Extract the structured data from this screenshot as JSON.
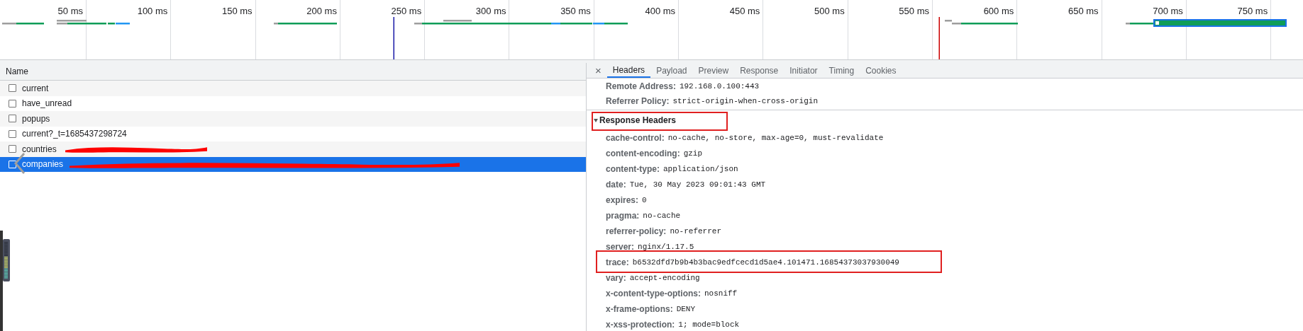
{
  "timeline": {
    "ticks": [
      "50 ms",
      "100 ms",
      "150 ms",
      "200 ms",
      "250 ms",
      "300 ms",
      "350 ms",
      "400 ms",
      "450 ms",
      "500 ms",
      "550 ms",
      "600 ms",
      "650 ms",
      "700 ms",
      "750 ms"
    ]
  },
  "request_list": {
    "column": "Name",
    "rows": [
      {
        "name": "current",
        "selected": false
      },
      {
        "name": "have_unread",
        "selected": false
      },
      {
        "name": "popups",
        "selected": false
      },
      {
        "name": "current?_t=1685437298724",
        "selected": false
      },
      {
        "name": "countries",
        "selected": false,
        "redacted": true
      },
      {
        "name": "companies",
        "selected": true,
        "redacted": true
      }
    ]
  },
  "details": {
    "close": "×",
    "tabs": [
      {
        "label": "Headers",
        "selected": true
      },
      {
        "label": "Payload",
        "selected": false
      },
      {
        "label": "Preview",
        "selected": false
      },
      {
        "label": "Response",
        "selected": false
      },
      {
        "label": "Initiator",
        "selected": false
      },
      {
        "label": "Timing",
        "selected": false
      },
      {
        "label": "Cookies",
        "selected": false
      }
    ],
    "general": [
      {
        "label": "Remote Address:",
        "value": "192.168.0.100:443"
      },
      {
        "label": "Referrer Policy:",
        "value": "strict-origin-when-cross-origin"
      }
    ],
    "response_headers": {
      "title": "Response Headers",
      "expanded": true,
      "highlighted": true,
      "headers": [
        {
          "name": "cache-control:",
          "value": "no-cache, no-store, max-age=0, must-revalidate",
          "highlighted": false
        },
        {
          "name": "content-encoding:",
          "value": "gzip",
          "highlighted": false
        },
        {
          "name": "content-type:",
          "value": "application/json",
          "highlighted": false
        },
        {
          "name": "date:",
          "value": "Tue, 30 May 2023 09:01:43 GMT",
          "highlighted": false
        },
        {
          "name": "expires:",
          "value": "0",
          "highlighted": false
        },
        {
          "name": "pragma:",
          "value": "no-cache",
          "highlighted": false
        },
        {
          "name": "referrer-policy:",
          "value": "no-referrer",
          "highlighted": false
        },
        {
          "name": "server:",
          "value": "nginx/1.17.5",
          "highlighted": false
        },
        {
          "name": "trace:",
          "value": "b6532dfd7b9b4b3bac9edfcecd1d5ae4.101471.16854373037930049",
          "highlighted": true
        },
        {
          "name": "vary:",
          "value": "accept-encoding",
          "highlighted": false
        },
        {
          "name": "x-content-type-options:",
          "value": "nosniff",
          "highlighted": false
        },
        {
          "name": "x-frame-options:",
          "value": "DENY",
          "highlighted": false
        },
        {
          "name": "x-xss-protection:",
          "value": "1; mode=block",
          "highlighted": false
        }
      ]
    }
  }
}
